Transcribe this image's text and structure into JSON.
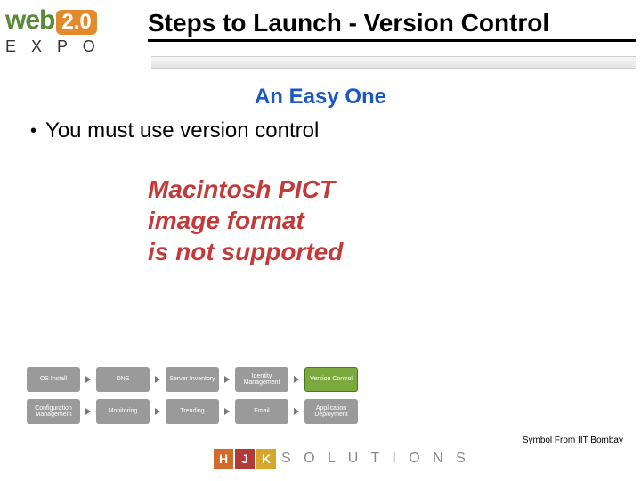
{
  "header": {
    "logo": {
      "part1": "web",
      "part2": "2.0",
      "part3": "E X P O"
    },
    "title": "Steps to Launch - Version Control"
  },
  "content": {
    "subtitle": "An Easy One",
    "bullets": [
      "You must use version control"
    ],
    "pict_message": {
      "line1": "Macintosh PICT",
      "line2": "image format",
      "line3": "is not supported"
    }
  },
  "flow": {
    "row1": [
      "OS Install",
      "DNS",
      "Server Inventory",
      "Identity Management",
      "Version Control"
    ],
    "row2": [
      "Configuration Management",
      "Monitoring",
      "Trending",
      "Email",
      "Application Deployment"
    ],
    "highlight": "Version Control"
  },
  "footer": {
    "hjk": [
      "H",
      "J",
      "K"
    ],
    "solutions": "S O L U T I O N S",
    "attribution": "Symbol From IIT Bombay"
  }
}
